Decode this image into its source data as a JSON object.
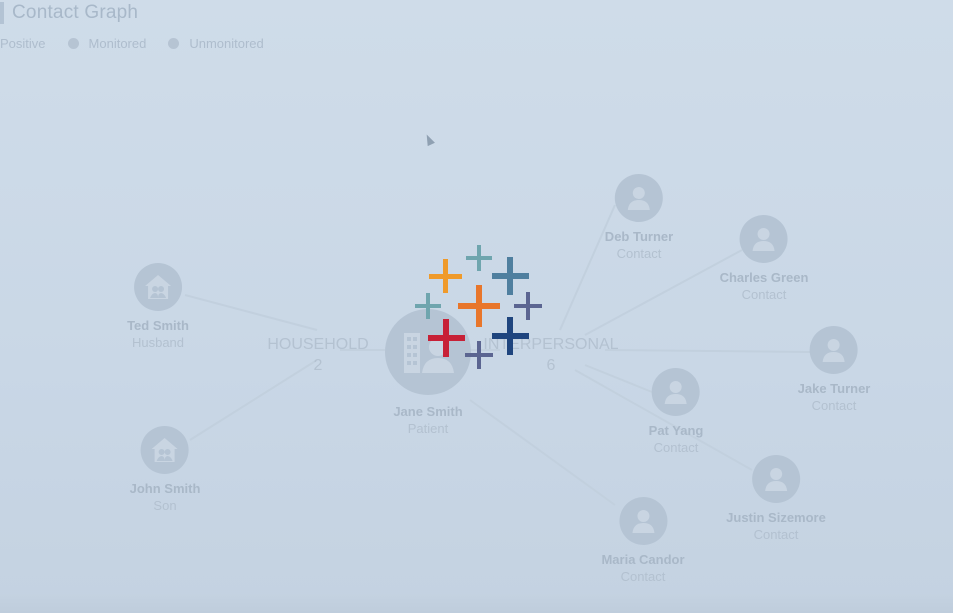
{
  "title": "Contact Graph",
  "legend": [
    {
      "label": "Positive"
    },
    {
      "label": "Monitored"
    },
    {
      "label": "Unmonitored"
    }
  ],
  "groups": {
    "household": {
      "label": "HOUSEHOLD",
      "count": "2"
    },
    "interpersonal": {
      "label": "INTERPERSONAL",
      "count": "6"
    }
  },
  "patient": {
    "name": "Jane Smith",
    "role": "Patient"
  },
  "household_members": [
    {
      "name": "Ted Smith",
      "role": "Husband"
    },
    {
      "name": "John Smith",
      "role": "Son"
    }
  ],
  "contacts": [
    {
      "name": "Deb Turner",
      "role": "Contact"
    },
    {
      "name": "Charles Green",
      "role": "Contact"
    },
    {
      "name": "Jake Turner",
      "role": "Contact"
    },
    {
      "name": "Pat Yang",
      "role": "Contact"
    },
    {
      "name": "Justin Sizemore",
      "role": "Contact"
    },
    {
      "name": "Maria Candor",
      "role": "Contact"
    }
  ],
  "loading_overlay": {
    "icon": "tableau-loading-logo"
  },
  "colors": {
    "background": "#cfdbe8",
    "node_fill": "#b5c4d4",
    "edge": "#c3d1df",
    "logo_orange": "#e8762b",
    "logo_teal": "#5b9aa9",
    "logo_slate": "#4f7f9f",
    "logo_purple": "#5b6591",
    "logo_red": "#c72036",
    "logo_navy": "#1f457e"
  }
}
